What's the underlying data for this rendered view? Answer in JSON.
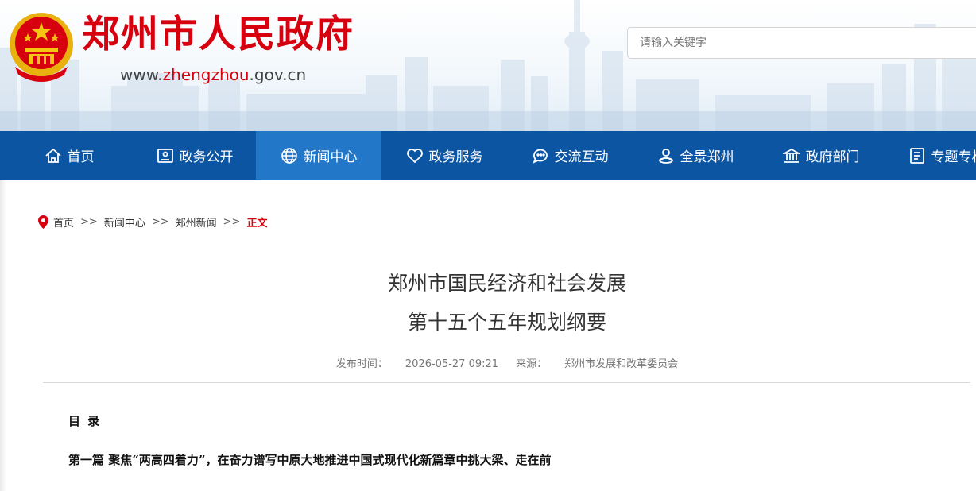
{
  "header": {
    "site_title": "郑州市人民政府",
    "url_prefix": "www.",
    "url_accent": "zhengzhou",
    "url_suffix": ".gov.cn",
    "search_placeholder": "请输入关键字"
  },
  "nav": {
    "items": [
      {
        "label": "首页",
        "icon": "home-icon"
      },
      {
        "label": "政务公开",
        "icon": "id-card-icon"
      },
      {
        "label": "新闻中心",
        "icon": "globe-icon",
        "active": true
      },
      {
        "label": "政务服务",
        "icon": "heart-icon"
      },
      {
        "label": "交流互动",
        "icon": "chat-icon"
      },
      {
        "label": "全景郑州",
        "icon": "user-location-icon"
      },
      {
        "label": "政府部门",
        "icon": "bank-icon"
      },
      {
        "label": "专题专栏",
        "icon": "list-icon"
      }
    ]
  },
  "breadcrumb": {
    "items": [
      "首页",
      "新闻中心",
      "郑州新闻"
    ],
    "separator": ">>",
    "current": "正文"
  },
  "article": {
    "title_line1": "郑州市国民经济和社会发展",
    "title_line2": "第十五个五年规划纲要",
    "publish_label": "发布时间：",
    "publish_time": "2026-05-27 09:21",
    "source_label": "来源：",
    "source": "郑州市发展和改革委员会",
    "toc_heading": "目 录",
    "part1": "第一篇 聚焦“两高四着力”，在奋力谱写中原大地推进中国式现代化新篇章中挑大梁、走在前"
  },
  "colors": {
    "brand_red": "#d7000f",
    "nav_blue": "#0c55a3",
    "nav_active": "#2277c9"
  }
}
